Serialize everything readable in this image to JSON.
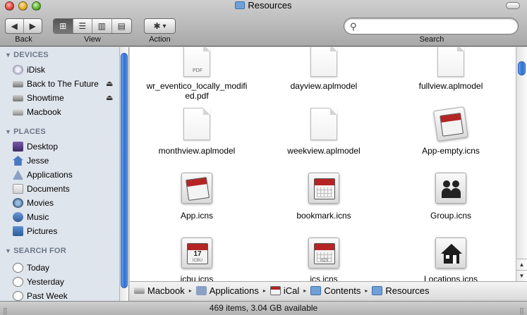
{
  "window": {
    "title": "Resources"
  },
  "toolbar": {
    "back_label": "Back",
    "view_label": "View",
    "action_label": "Action",
    "search_label": "Search",
    "search_value": "",
    "back_glyph": "◀",
    "forward_glyph": "▶",
    "view_icons_glyph": "⊞",
    "view_list_glyph": "☰",
    "view_columns_glyph": "▥",
    "view_coverflow_glyph": "▤",
    "action_glyph": "✱",
    "action_caret": "▾"
  },
  "sidebar": {
    "devices_label": "DEVICES",
    "places_label": "PLACES",
    "search_for_label": "SEARCH FOR",
    "devices": [
      {
        "label": "iDisk",
        "icon": "idisk-icon"
      },
      {
        "label": "Back to The Future",
        "icon": "drive-icon",
        "eject": "⏏"
      },
      {
        "label": "Showtime",
        "icon": "drive-icon",
        "eject": "⏏"
      },
      {
        "label": "Macbook",
        "icon": "drive-icon"
      }
    ],
    "places": [
      {
        "label": "Desktop",
        "icon": "desktop-icon"
      },
      {
        "label": "Jesse",
        "icon": "home-icon"
      },
      {
        "label": "Applications",
        "icon": "applications-icon"
      },
      {
        "label": "Documents",
        "icon": "documents-icon"
      },
      {
        "label": "Movies",
        "icon": "movies-icon"
      },
      {
        "label": "Music",
        "icon": "music-icon"
      },
      {
        "label": "Pictures",
        "icon": "pictures-icon"
      }
    ],
    "search_for": [
      {
        "label": "Today",
        "icon": "clock-icon"
      },
      {
        "label": "Yesterday",
        "icon": "clock-icon"
      },
      {
        "label": "Past Week",
        "icon": "clock-icon"
      }
    ]
  },
  "files": [
    {
      "name": "wr_eventico_locally_modifi",
      "name2": "ed.pdf",
      "kind": "pdf-document-icon",
      "badge": "PDF"
    },
    {
      "name": "dayview.aplmodel",
      "kind": "document-icon"
    },
    {
      "name": "fullview.aplmodel",
      "kind": "document-icon"
    },
    {
      "name": "monthview.aplmodel",
      "kind": "document-icon"
    },
    {
      "name": "weekview.aplmodel",
      "kind": "document-icon"
    },
    {
      "name": "App-empty.icns",
      "kind": "ical-app-icon"
    },
    {
      "name": "App.icns",
      "kind": "ical-app-icon"
    },
    {
      "name": "bookmark.icns",
      "kind": "calendar-bookmark-icon"
    },
    {
      "name": "Group.icns",
      "kind": "group-icon"
    },
    {
      "name": "icbu.icns",
      "kind": "calendar-icbu-icon",
      "badge": "ICBU",
      "day": "17"
    },
    {
      "name": "ics.icns",
      "kind": "calendar-ics-icon",
      "badge": "ICS"
    },
    {
      "name": "Locations.icns",
      "kind": "house-icon"
    }
  ],
  "pathbar": {
    "crumbs": [
      "Macbook",
      "iCal",
      "Contents",
      "Resources"
    ],
    "applications": "Applications",
    "separator": "▸"
  },
  "status": {
    "text": "469 items, 3.04 GB available"
  },
  "colors": {
    "selection_blue": "#2e6fd1",
    "sidebar_bg": "#dfe5ed",
    "calendar_red": "#b52424"
  }
}
